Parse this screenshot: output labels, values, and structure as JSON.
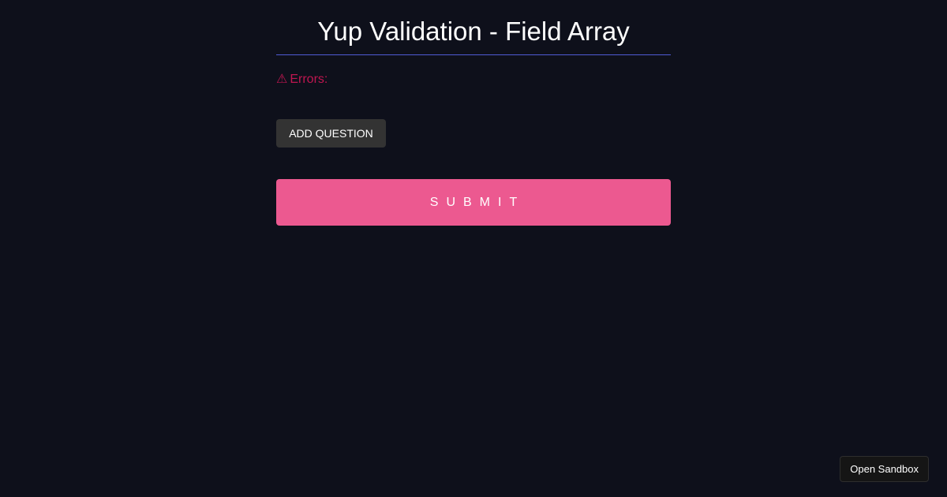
{
  "form": {
    "title": "Yup Validation - Field Array",
    "errors_icon": "⚠",
    "errors_label": "Errors:",
    "add_question_label": "ADD QUESTION",
    "submit_label": "SUBMIT"
  },
  "footer": {
    "open_sandbox_label": "Open Sandbox"
  },
  "colors": {
    "background": "#0e101b",
    "divider": "#4f5bd5",
    "error": "#bf1650",
    "submit": "#ec5990",
    "add_button": "#333333"
  },
  "icons": {
    "errors_icon_name": "warning-icon"
  }
}
